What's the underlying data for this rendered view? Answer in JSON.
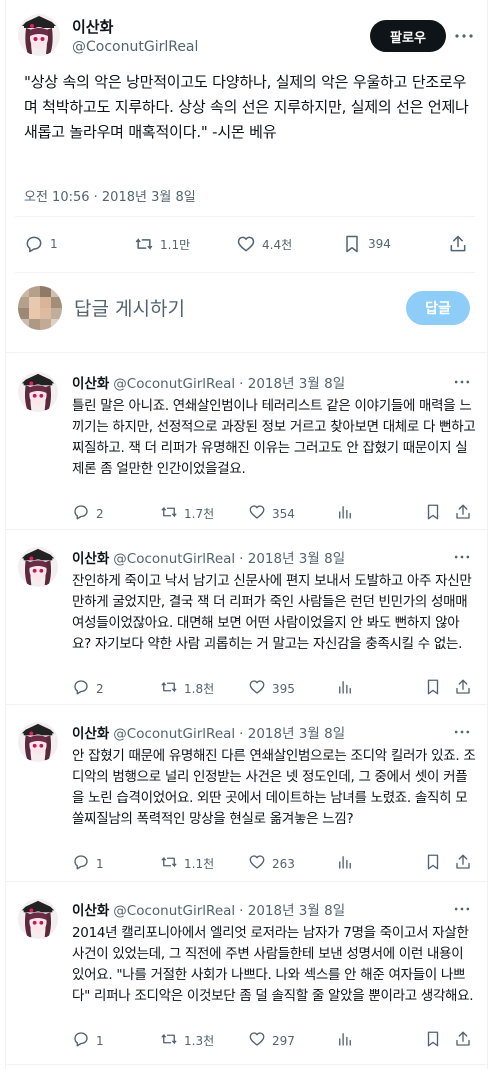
{
  "main_tweet": {
    "display_name": "이산화",
    "handle": "@CoconutGirlReal",
    "follow_label": "팔로우",
    "text": "\"상상 속의 악은 낭만적이고도 다양하나, 실제의 악은 우울하고 단조로우며 척박하고도 지루하다. 상상 속의 선은 지루하지만, 실제의 선은 언제나 새롭고 놀라우며 매혹적이다.\" -시몬 베유",
    "timestamp": "오전 10:56 · 2018년 3월 8일",
    "stats": {
      "replies": "1",
      "retweets": "1.1만",
      "likes": "4.4천",
      "bookmarks": "394"
    }
  },
  "reply_box": {
    "placeholder": "답글 게시하기",
    "button_label": "답글"
  },
  "replies": [
    {
      "display_name": "이산화",
      "handle": "@CoconutGirlReal",
      "date": "· 2018년 3월 8일",
      "text": "틀린 말은 아니죠. 연쇄살인범이나 테러리스트 같은 이야기들에 매력을 느끼기는 하지만, 선정적으로 과장된 정보 거르고 찾아보면 대체로 다 뻔하고 찌질하고. 잭 더 리퍼가 유명해진 이유는 그러고도 안 잡혔기 때문이지 실제론 좀 얼만한 인간이었을걸요.",
      "stats": {
        "replies": "2",
        "retweets": "1.7천",
        "likes": "354"
      }
    },
    {
      "display_name": "이산화",
      "handle": "@CoconutGirlReal",
      "date": "· 2018년 3월 8일",
      "text": "잔인하게 죽이고 낙서 남기고 신문사에 편지 보내서 도발하고 아주 자신만만하게 굴었지만, 결국 잭 더 리퍼가 죽인 사람들은 런던 빈민가의 성매매 여성들이었잖아요. 대면해 보면 어떤 사람이었을지 안 봐도 뻔하지 않아요? 자기보다 약한 사람 괴롭히는 거 말고는 자신감을 충족시킬 수 없는.",
      "stats": {
        "replies": "2",
        "retweets": "1.8천",
        "likes": "395"
      }
    },
    {
      "display_name": "이산화",
      "handle": "@CoconutGirlReal",
      "date": "· 2018년 3월 8일",
      "text": "안 잡혔기 때문에 유명해진 다른 연쇄살인범으로는 조디악 킬러가 있죠. 조디악의 범행으로 널리 인정받는 사건은 넷 정도인데, 그 중에서 셋이 커플을 노린 습격이었어요. 외딴 곳에서 데이트하는 남녀를 노렸죠. 솔직히 모쏠찌질남의 폭력적인 망상을 현실로 옮겨놓은 느낌?",
      "stats": {
        "replies": "1",
        "retweets": "1.1천",
        "likes": "263"
      }
    },
    {
      "display_name": "이산화",
      "handle": "@CoconutGirlReal",
      "date": "· 2018년 3월 8일",
      "text": "2014년 캘리포니아에서 엘리엇 로저라는 남자가 7명을 죽이고서 자살한 사건이 있었는데, 그 직전에 주변 사람들한테 보낸 성명서에 이런 내용이 있어요. \"나를 거절한 사회가 나쁘다. 나와 섹스를 안 해준 여자들이 나쁘다\" 리퍼나 조디악은 이것보단 좀 덜 솔직할 줄 알았을 뿐이라고 생각해요.",
      "stats": {
        "replies": "1",
        "retweets": "1.3천",
        "likes": "297"
      }
    }
  ],
  "icons": [
    "reply-icon",
    "retweet-icon",
    "like-icon",
    "bookmark-icon",
    "share-icon",
    "views-icon",
    "more-icon"
  ],
  "colors": {
    "follow_bg": "#0f1419",
    "reply_btn_bg": "#8ecdf8",
    "secondary_text": "#536471"
  }
}
